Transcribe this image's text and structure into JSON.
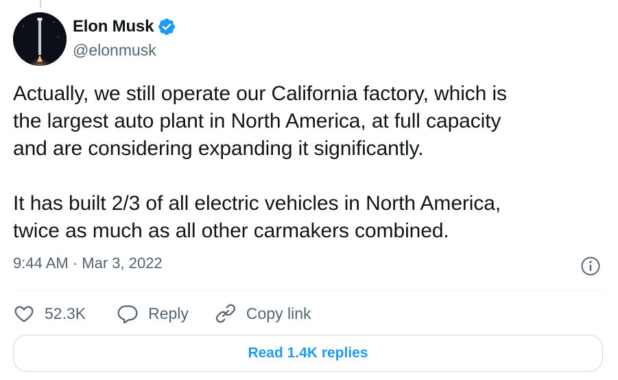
{
  "author": {
    "display_name": "Elon Musk",
    "handle": "@elonmusk",
    "verified": true
  },
  "tweet": {
    "text": "Actually, we still operate our California factory, which is\nthe largest auto plant in North America, at full capacity\nand are considering expanding it significantly.\n\nIt has built 2/3 of all electric vehicles in North America,\ntwice as much as all other carmakers combined.",
    "timestamp": "9:44 AM · Mar 3, 2022"
  },
  "actions": {
    "like_count": "52.3K",
    "reply_label": "Reply",
    "copy_link_label": "Copy link"
  },
  "read_replies_label": "Read 1.4K replies",
  "icons": {
    "verified": "verified-badge-icon",
    "info": "info-icon",
    "like": "heart-icon",
    "reply": "speech-bubble-icon",
    "copy_link": "link-icon"
  },
  "colors": {
    "accent": "#1d9bf0",
    "text_primary": "#0f1419",
    "text_secondary": "#536471",
    "border": "#cfd9de"
  }
}
